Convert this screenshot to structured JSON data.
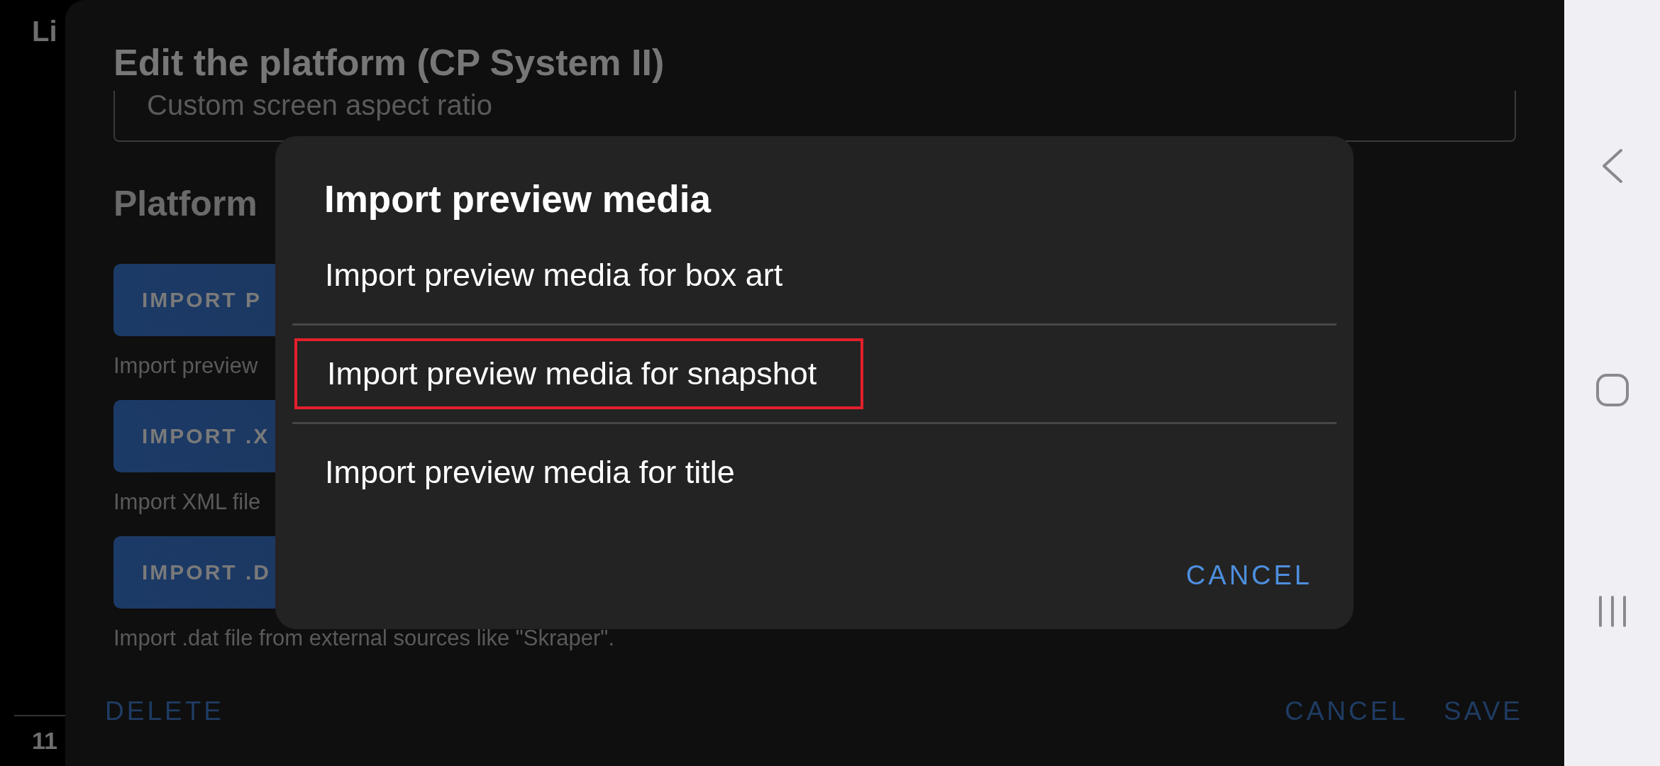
{
  "background_app": {
    "title_partial": "Li",
    "footer_partial": "11"
  },
  "edit_dialog": {
    "title": "Edit the platform (CP System II)",
    "field": {
      "placeholder": "Custom screen aspect ratio"
    },
    "section_heading": "Platform",
    "actions": [
      {
        "label": "IMPORT P",
        "description": "Import preview"
      },
      {
        "label": "IMPORT .X",
        "description": "Import XML file"
      },
      {
        "label": "IMPORT .D",
        "description": "Import .dat file from external sources like \"Skraper\"."
      }
    ],
    "footer": {
      "delete": "DELETE",
      "cancel": "CANCEL",
      "save": "SAVE"
    }
  },
  "import_dialog": {
    "title": "Import preview media",
    "items": [
      {
        "label": "Import preview media for box art",
        "highlighted": false
      },
      {
        "label": "Import preview media for snapshot",
        "highlighted": true
      },
      {
        "label": "Import preview media for title",
        "highlighted": false
      }
    ],
    "cancel": "CANCEL"
  }
}
